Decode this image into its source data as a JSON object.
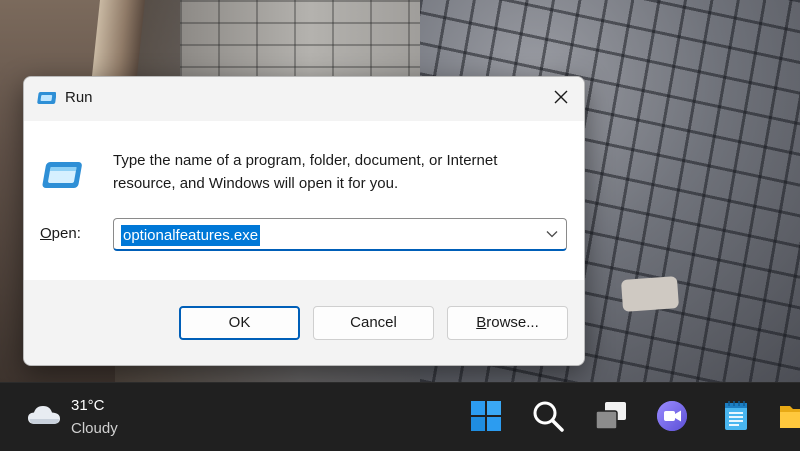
{
  "dialog": {
    "title": "Run",
    "description": "Type the name of a program, folder, document, or Internet resource, and Windows will open it for you.",
    "open_label_accel": "O",
    "open_label_rest": "pen:",
    "input_value": "optionalfeatures.exe",
    "buttons": {
      "ok": "OK",
      "cancel": "Cancel",
      "browse_accel": "B",
      "browse_rest": "rowse..."
    }
  },
  "taskbar": {
    "weather": {
      "temperature": "31°C",
      "condition": "Cloudy"
    },
    "icons": [
      "windows-start-icon",
      "search-icon",
      "task-view-icon",
      "teams-chat-icon",
      "notepad-icon",
      "file-explorer-icon"
    ]
  },
  "colors": {
    "accent": "#005fb8",
    "selection": "#0078d7",
    "taskbar": "#202020"
  }
}
